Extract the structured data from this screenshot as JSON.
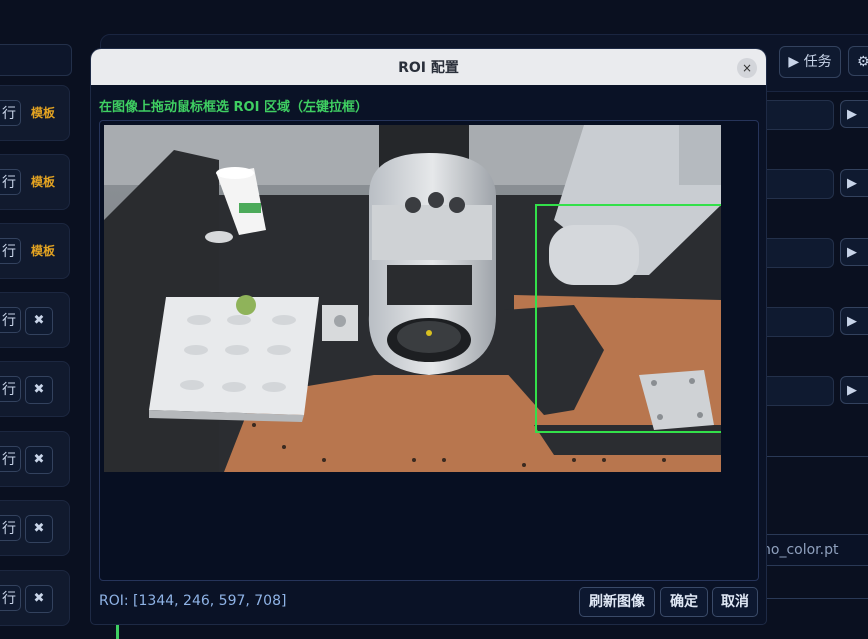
{
  "background": {
    "left_rows": [
      {
        "run_label": "行",
        "template_label": "模板"
      },
      {
        "run_label": "行",
        "template_label": "模板"
      },
      {
        "run_label": "行",
        "template_label": "模板"
      },
      {
        "run_label": "行",
        "delete_label": "✖"
      },
      {
        "run_label": "行",
        "delete_label": "✖"
      },
      {
        "run_label": "行",
        "delete_label": "✖"
      },
      {
        "run_label": "行",
        "delete_label": "✖"
      },
      {
        "run_label": "行",
        "delete_label": "✖"
      }
    ],
    "task_button": "▶ 任务",
    "gear_button": "⚙",
    "right_play_label": "▶ ",
    "model_field_value": "no_color.pt"
  },
  "modal": {
    "title": "ROI 配置",
    "close_label": "×",
    "instruction": "在图像上拖动鼠标框选 ROI 区域（左键拉框）",
    "roi_readout": "ROI: [1344, 246, 597, 708]",
    "buttons": {
      "refresh": "刷新图像",
      "confirm": "确定",
      "cancel": "取消"
    }
  },
  "colors": {
    "accent_green": "#3fcf62",
    "template_orange": "#e3a322",
    "roi_box": "#33e04a"
  }
}
